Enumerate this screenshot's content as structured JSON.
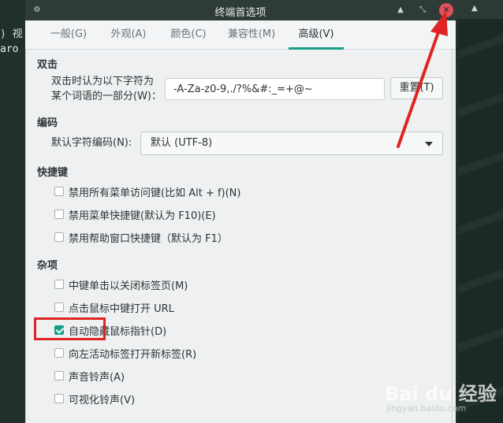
{
  "background": {
    "term_line1": ") 视",
    "term_line2": "aro"
  },
  "window": {
    "title": "终端首选项"
  },
  "tabs": [
    {
      "label": "一般(G)"
    },
    {
      "label": "外观(A)"
    },
    {
      "label": "颜色(C)"
    },
    {
      "label": "兼容性(M)"
    },
    {
      "label": "高级(V)"
    }
  ],
  "double_click": {
    "section": "双击",
    "label_line1": "双击时认为以下字符为",
    "label_line2": "某个词语的一部分(W)：",
    "value": "-A-Za-z0-9,./?%&#:_=+@~",
    "reset_label": "重置(T)"
  },
  "encoding": {
    "section": "编码",
    "label": "默认字符编码(N):",
    "selected": "默认 (UTF-8)"
  },
  "shortcuts": {
    "section": "快捷键",
    "items": [
      {
        "label": "禁用所有菜单访问键(比如 Alt + f)(N)",
        "checked": false
      },
      {
        "label": "禁用菜单快捷键(默认为 F10)(E)",
        "checked": false
      },
      {
        "label": "禁用帮助窗口快捷键（默认为 F1）",
        "checked": false
      }
    ]
  },
  "misc": {
    "section": "杂项",
    "items": [
      {
        "label": "中键单击以关闭标签页(M)",
        "checked": false
      },
      {
        "label": "点击鼠标中键打开 URL",
        "checked": false
      },
      {
        "label": "自动隐藏鼠标指针(D)",
        "checked": true
      },
      {
        "label": "向左活动标签打开新标签(R)",
        "checked": false
      },
      {
        "label": "声音铃声(A)",
        "checked": false
      },
      {
        "label": "可视化铃声(V)",
        "checked": false
      }
    ]
  },
  "colors": {
    "accent": "#16a085",
    "annotation": "#e02424",
    "close": "#e0515b"
  },
  "watermark": {
    "text": "Bai du 经验",
    "sub": "jingyan.baidu.com"
  }
}
